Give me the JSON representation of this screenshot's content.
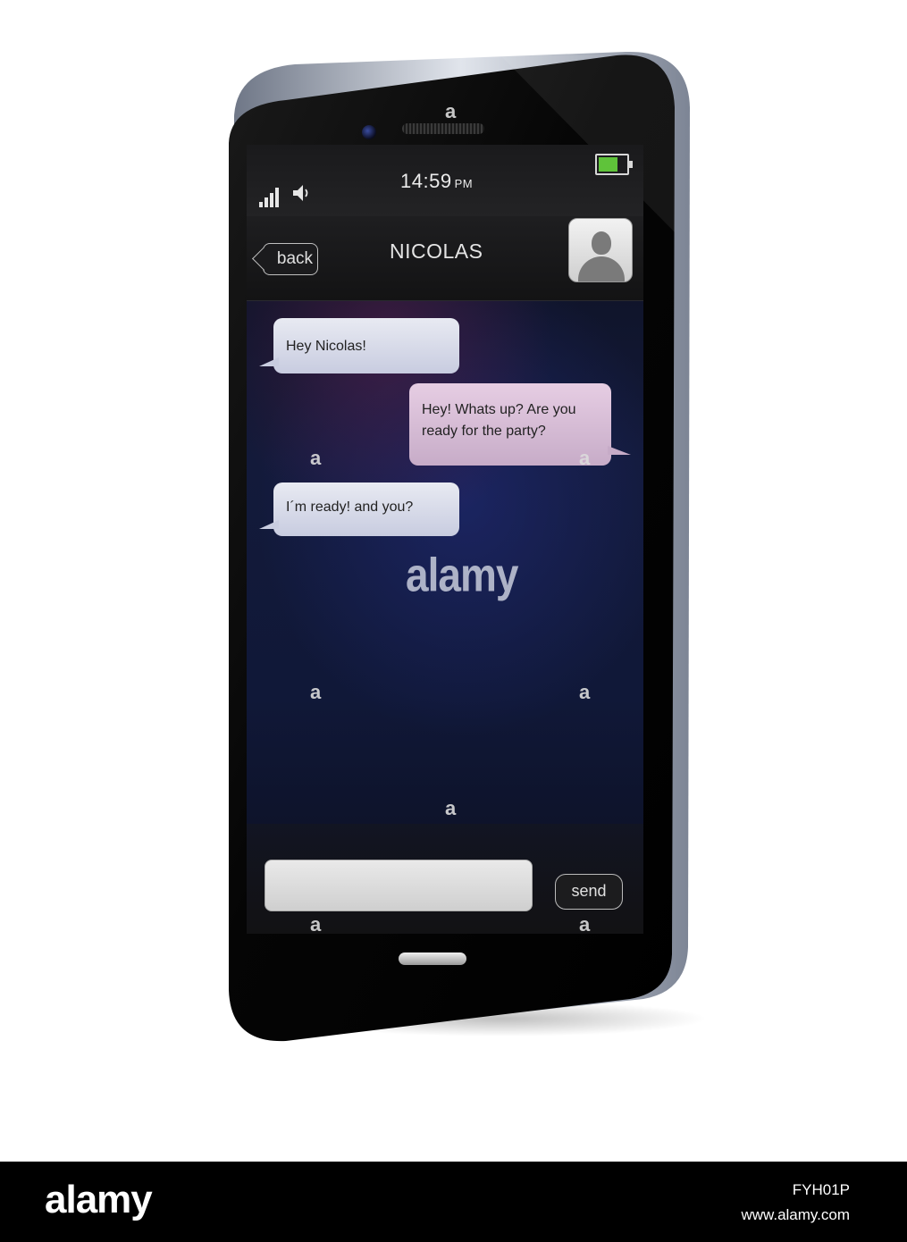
{
  "status_bar": {
    "time": "14:59",
    "ampm": "PM"
  },
  "header": {
    "back_label": "back",
    "contact_name": "NICOLAS"
  },
  "messages": [
    {
      "direction": "incoming",
      "text": "Hey Nicolas!"
    },
    {
      "direction": "outgoing",
      "text": "Hey! Whats up? Are you ready for the party?"
    },
    {
      "direction": "incoming",
      "text": "I´m ready! and you?"
    }
  ],
  "composer": {
    "send_label": "send"
  },
  "watermark": {
    "text": "alamy",
    "mark": "a"
  },
  "footer": {
    "logo": "alamy",
    "image_id": "FYH01P",
    "url": "www.alamy.com"
  },
  "colors": {
    "incoming_bubble": "#c8cce0",
    "outgoing_bubble": "#c7acc8",
    "battery": "#5fc33a"
  }
}
